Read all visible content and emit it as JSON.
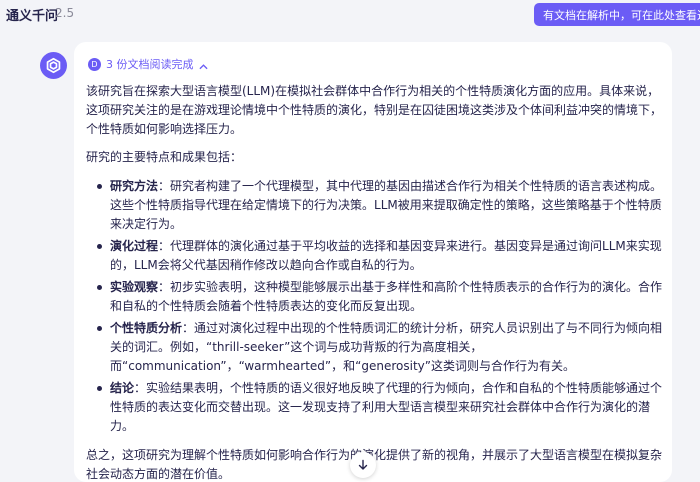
{
  "header": {
    "title": "通义千问",
    "version": "2.5"
  },
  "banner": {
    "text": "有文档在解析中，可在此处查看进度"
  },
  "status": {
    "doc_icon_letter": "D",
    "text": "3 份文档阅读完成"
  },
  "answer": {
    "intro": "该研究旨在探索大型语言模型(LLM)在模拟社会群体中合作行为相关的个性特质演化方面的应用。具体来说，这项研究关注的是在游戏理论情境中个性特质的演化，特别是在囚徒困境这类涉及个体间利益冲突的情境下，个性特质如何影响选择压力。",
    "lead": "研究的主要特点和成果包括：",
    "points": [
      {
        "title": "研究方法",
        "text": "：研究者构建了一个代理模型，其中代理的基因由描述合作行为相关个性特质的语言表述构成。这些个性特质指导代理在给定情境下的行为决策。LLM被用来提取确定性的策略，这些策略基于个性特质来决定行为。"
      },
      {
        "title": "演化过程",
        "text": "：代理群体的演化通过基于平均收益的选择和基因变异来进行。基因变异是通过询问LLM来实现的，LLM会将父代基因稍作修改以趋向合作或自私的行为。"
      },
      {
        "title": "实验观察",
        "text": "：初步实验表明，这种模型能够展示出基于多样性和高阶个性特质表示的合作行为的演化。合作和自私的个性特质会随着个性特质表达的变化而反复出现。"
      },
      {
        "title": "个性特质分析",
        "text": "：通过对演化过程中出现的个性特质词汇的统计分析，研究人员识别出了与不同行为倾向相关的词汇。例如，“thrill-seeker”这个词与成功背叛的行为高度相关，而“communication”，“warmhearted”，和“generosity”这类词则与合作行为有关。"
      },
      {
        "title": "结论",
        "text": "：实验结果表明，个性特质的语义很好地反映了代理的行为倾向，合作和自私的个性特质能够通过个性特质的表达变化而交替出现。这一发现支持了利用大型语言模型来研究社会群体中合作行为演化的潜力。"
      }
    ],
    "conclusion": "总之，这项研究为理解个性特质如何影响合作行为的演化提供了新的视角，并展示了大型语言模型在模拟复杂社会动态方面的潜在价值。"
  },
  "icons": {
    "avatar": "tongyi-logo-icon",
    "scroll": "arrow-down-icon",
    "collapse": "chevron-up-icon"
  },
  "colors": {
    "accent": "#6b5cf5",
    "text": "#26244c",
    "background": "#f3f4f8"
  }
}
